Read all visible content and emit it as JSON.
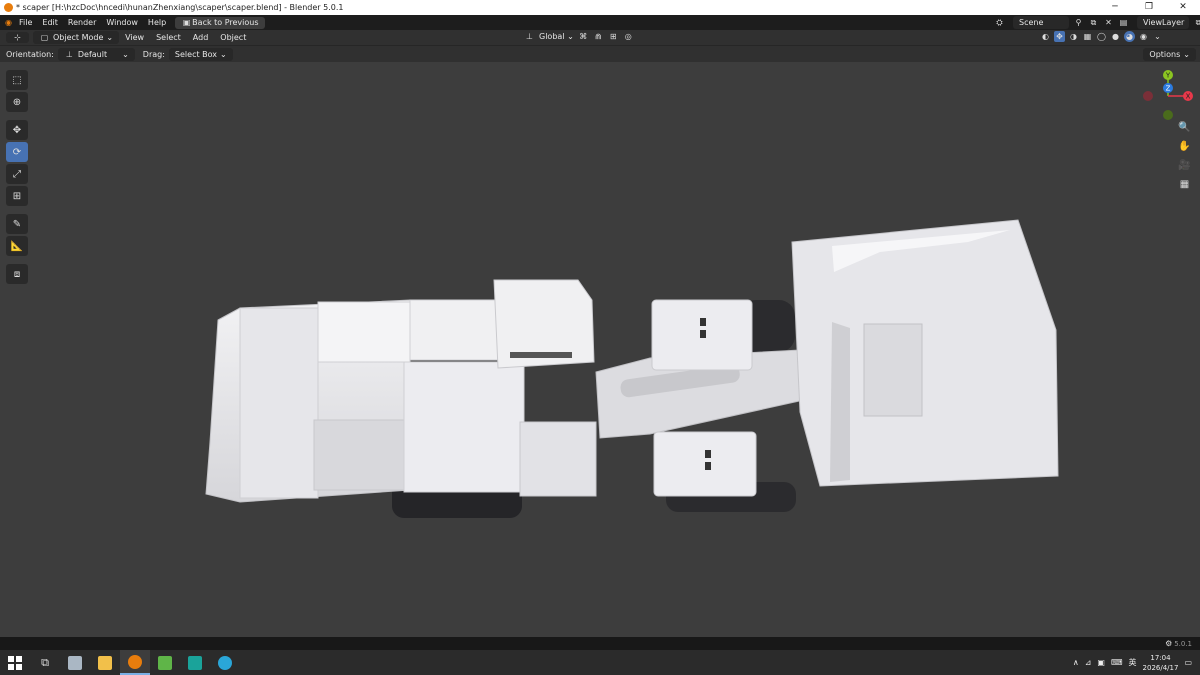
{
  "window": {
    "title": "* scaper [H:\\hzcDoc\\hncedi\\hunanZhenxiang\\scaper\\scaper.blend] - Blender 5.0.1",
    "min": "─",
    "max": "❐",
    "close": "✕"
  },
  "menu": {
    "items": [
      "File",
      "Edit",
      "Render",
      "Window",
      "Help"
    ],
    "back_label": "Back to Previous",
    "scene_label": "Scene",
    "viewlayer_label": "ViewLayer"
  },
  "header": {
    "mode": "Object Mode",
    "menus": [
      "View",
      "Select",
      "Add",
      "Object"
    ],
    "transform": "Global"
  },
  "tool_options": {
    "orientation_label": "Orientation:",
    "orientation_value": "Default",
    "drag_label": "Drag:",
    "drag_value": "Select Box",
    "options_label": "Options"
  },
  "gizmo": {
    "y": "Y",
    "z": "Z",
    "x": "X",
    "colors": {
      "x": "#e8384a",
      "y": "#8bc421",
      "z": "#2b7be0"
    }
  },
  "status": {
    "version": "5.0.1"
  },
  "taskbar": {
    "time": "17:04",
    "date": "2026/4/17",
    "ime": "英"
  }
}
